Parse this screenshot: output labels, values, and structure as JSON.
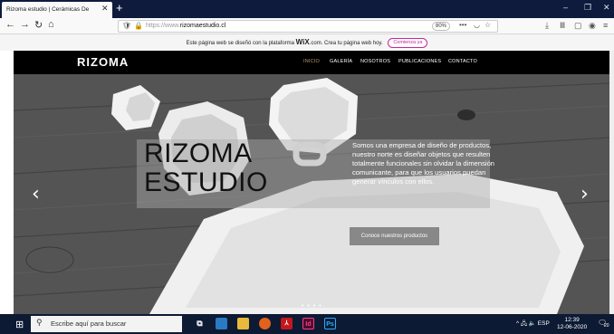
{
  "browser": {
    "tab_title": "Rizoma estudio | Cerámicas De",
    "tab_close": "✕",
    "new_tab": "+",
    "url_prefix": "https://www.",
    "url_host": "rizomaestudio.cl",
    "zoom": "80%",
    "window_controls": [
      "–",
      "❐",
      "✕"
    ],
    "nav_icons": [
      "back-icon",
      "forward-icon",
      "reload-icon",
      "home-icon"
    ],
    "toolbar_icons": [
      "download-icon",
      "library-icon",
      "sidebar-icon",
      "account-icon",
      "menu-icon"
    ]
  },
  "wix_banner": {
    "text_before": "Este página web se diseñó con la plataforma ",
    "logo": "WiX",
    "text_after": ".com. Crea tu página web hoy.",
    "button": "Comienza ya"
  },
  "site": {
    "logo": "RIZOMA",
    "menu": [
      "INICIO",
      "GALERÍA",
      "NOSOTROS",
      "PUBLICACIONES",
      "CONTACTO"
    ],
    "active_menu": "INICIO"
  },
  "hero": {
    "title": "RIZOMA\nESTUDIO",
    "description": "Somos una empresa de diseño de productos, nuestro norte es diseñar objetos que resulten totalmente funcionales sin olvidar la dimensión comunicante, para que los usuarios puedan generar vínculos con ellos.",
    "cta": "Conoce nuestros productos",
    "prev_arrow": "‹",
    "next_arrow": "›",
    "slide_dots": "• • • •"
  },
  "taskbar": {
    "search_placeholder": "Escribe aquí para buscar",
    "apps": [
      "task-view-icon",
      "photos-icon",
      "file-explorer-icon",
      "firefox-icon",
      "acrobat-icon",
      "indesign-icon",
      "photoshop-icon"
    ],
    "app_labels": [
      "Id",
      "Ps"
    ],
    "tray_text": "^ 🖧 🔈 ESP",
    "time": "12:39",
    "date": "12-06-2020",
    "notification_count": "20"
  },
  "colors": {
    "browser_dark": "#0f1b3d",
    "taskbar": "#0d1a33",
    "accent_menu": "#b89a6b",
    "wix_pink": "#c5269c"
  }
}
